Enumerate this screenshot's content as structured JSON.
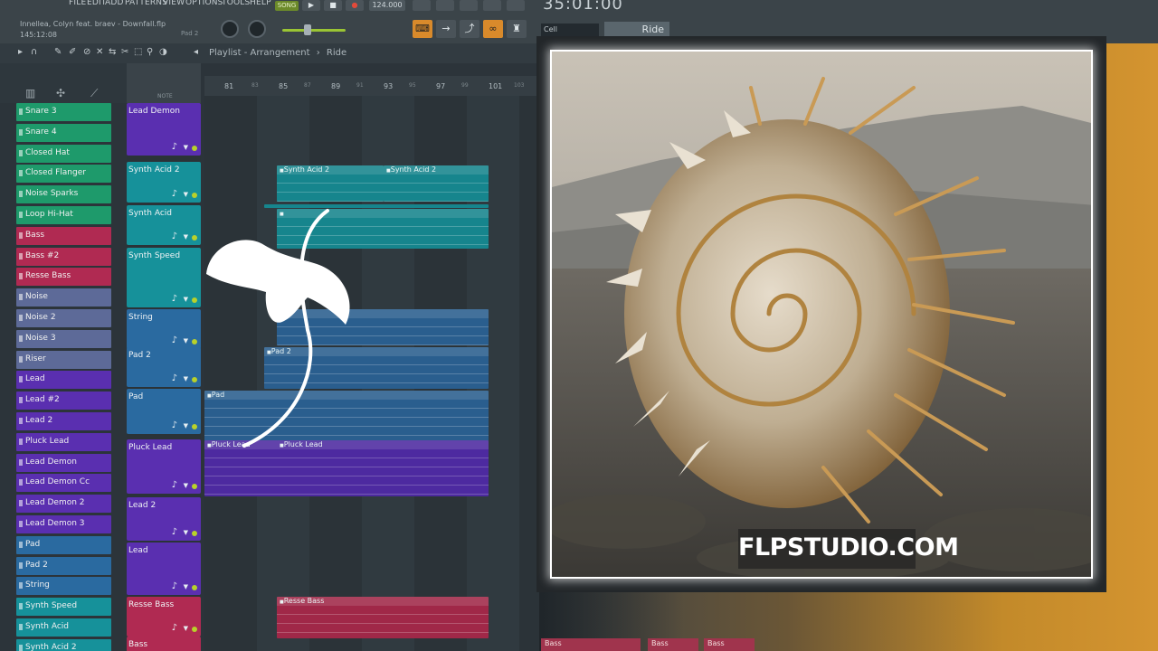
{
  "menu": [
    "FILE",
    "EDIT",
    "ADD",
    "PATTERNS",
    "VIEW",
    "OPTIONS",
    "TOOLS",
    "HELP"
  ],
  "song": {
    "title": "Innellea, Colyn feat. braev - Downfall.flp",
    "time": "145:12:08",
    "pad_label": "Pad 2",
    "mode": "SONG",
    "tempo": "124.000",
    "big_time": "35:01:00"
  },
  "toolbar": {
    "cell": "Cell",
    "ride": "Ride"
  },
  "playlist": {
    "breadcrumb": "Playlist - Arrangement",
    "separator": "›",
    "current": "Ride",
    "note_label": "NOTE"
  },
  "timeline": {
    "bars": [
      "81",
      "83",
      "85",
      "87",
      "89",
      "91",
      "93",
      "95",
      "97",
      "99",
      "101",
      "103"
    ]
  },
  "channels": [
    {
      "label": "Snare 3",
      "color": "#1e9a6b"
    },
    {
      "label": "Snare 4",
      "color": "#1e9a6b"
    },
    {
      "label": "Closed Hat",
      "color": "#1e9a6b"
    },
    {
      "label": "Closed Flanger",
      "color": "#1e9a6b"
    },
    {
      "label": "Noise Sparks",
      "color": "#1e9a6b"
    },
    {
      "label": "Loop Hi-Hat",
      "color": "#1e9a6b"
    },
    {
      "label": "Bass",
      "color": "#b02a52"
    },
    {
      "label": "Bass #2",
      "color": "#b02a52"
    },
    {
      "label": "Resse Bass",
      "color": "#b02a52"
    },
    {
      "label": "Noise",
      "color": "#5d6a98"
    },
    {
      "label": "Noise 2",
      "color": "#5d6a98"
    },
    {
      "label": "Noise 3",
      "color": "#5d6a98"
    },
    {
      "label": "Riser",
      "color": "#5d6a98"
    },
    {
      "label": "Lead",
      "color": "#5a2fb0"
    },
    {
      "label": "Lead #2",
      "color": "#5a2fb0"
    },
    {
      "label": "Lead 2",
      "color": "#5a2fb0"
    },
    {
      "label": "Pluck Lead",
      "color": "#5a2fb0"
    },
    {
      "label": "Lead Demon",
      "color": "#5a2fb0"
    },
    {
      "label": "Lead Demon Cc",
      "color": "#5a2fb0"
    },
    {
      "label": "Lead Demon 2",
      "color": "#5a2fb0"
    },
    {
      "label": "Lead Demon 3",
      "color": "#5a2fb0"
    },
    {
      "label": "Pad",
      "color": "#2a6aa0"
    },
    {
      "label": "Pad 2",
      "color": "#2a6aa0"
    },
    {
      "label": "String",
      "color": "#2a6aa0"
    },
    {
      "label": "Synth Speed",
      "color": "#16919a"
    },
    {
      "label": "Synth Acid",
      "color": "#16919a"
    },
    {
      "label": "Synth Acid 2",
      "color": "#16919a"
    }
  ],
  "tracks": [
    {
      "label": "Lead Demon",
      "color": "#5a2fb0"
    },
    {
      "label": "Synth Acid 2",
      "color": "#16919a"
    },
    {
      "label": "Synth Acid",
      "color": "#16919a"
    },
    {
      "label": "Synth Speed",
      "color": "#16919a"
    },
    {
      "label": "String",
      "color": "#2a6aa0"
    },
    {
      "label": "Pad 2",
      "color": "#2a6aa0"
    },
    {
      "label": "Pad",
      "color": "#2a6aa0"
    },
    {
      "label": "Pluck Lead",
      "color": "#5a2fb0"
    },
    {
      "label": "Lead 2",
      "color": "#5a2fb0"
    },
    {
      "label": "Lead",
      "color": "#5a2fb0"
    },
    {
      "label": "Resse Bass",
      "color": "#b02a52"
    },
    {
      "label": "Bass",
      "color": "#b02a52"
    }
  ],
  "clips": [
    {
      "label": "Synth Acid 2",
      "color": "#16858d"
    },
    {
      "label": "Synth Acid 2",
      "color": "#16858d"
    },
    {
      "label": "",
      "color": "#16858d"
    },
    {
      "label": "",
      "color": "#16858d"
    },
    {
      "label": "",
      "color": "#2a5e8e"
    },
    {
      "label": "Pad 2",
      "color": "#2a5e8e"
    },
    {
      "label": "Pad",
      "color": "#2a5e8e"
    },
    {
      "label": "Pluck Lead",
      "color": "#4d2aa0"
    },
    {
      "label": "Pluck Lead",
      "color": "#4d2aa0"
    },
    {
      "label": "Resse Bass",
      "color": "#a02848"
    }
  ],
  "bottom_tags": [
    "Bass",
    "Bass",
    "Bass"
  ],
  "watermark": "FLPSTUDIO.COM",
  "icons": {
    "logo": "fl-studio-logo-icon",
    "piano": "piano-icon",
    "play": "play-icon",
    "stop": "stop-icon",
    "record": "record-icon"
  }
}
